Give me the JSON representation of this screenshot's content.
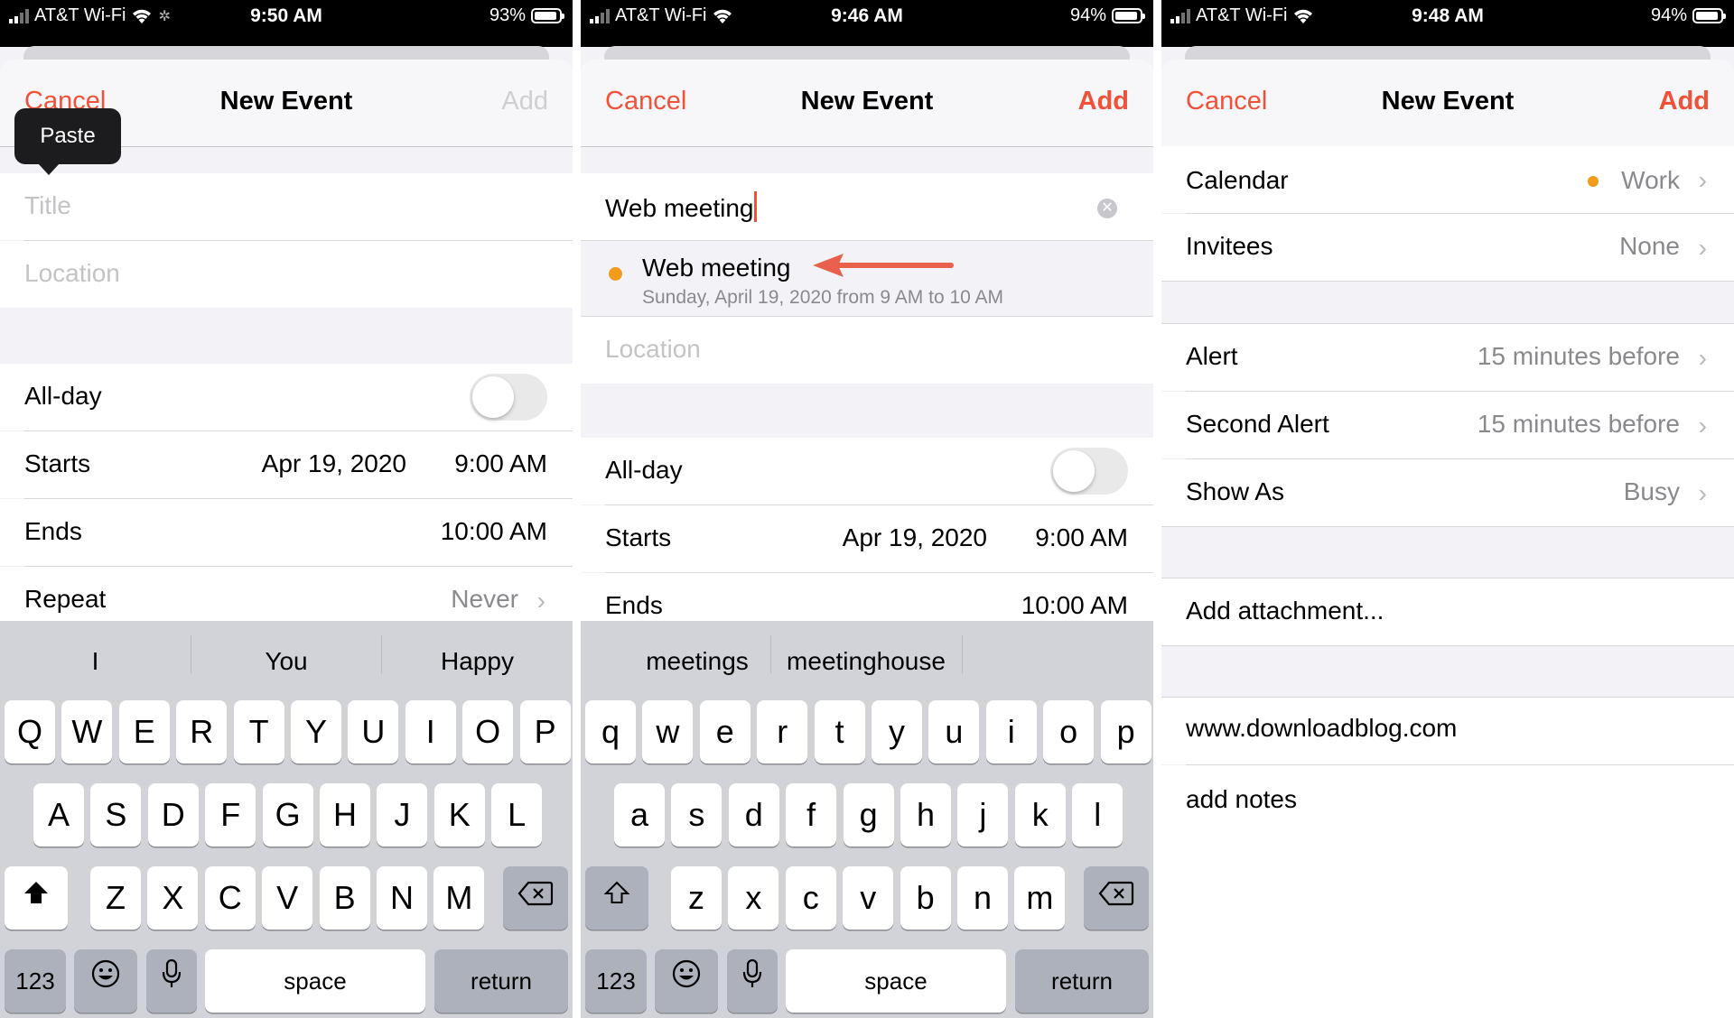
{
  "colors": {
    "accent": "#f05138",
    "calendar_dot": "#f29b1d",
    "arrow": "#e9614c"
  },
  "panels": [
    {
      "status": {
        "carrier": "AT&T Wi-Fi",
        "time": "9:50 AM",
        "battery": "93%"
      },
      "nav": {
        "cancel": "Cancel",
        "title": "New Event",
        "add": "Add"
      },
      "tooltip": "Paste",
      "fields": {
        "title_placeholder": "Title",
        "location_placeholder": "Location"
      },
      "rows": {
        "allday": "All-day",
        "starts": "Starts",
        "starts_date": "Apr 19, 2020",
        "starts_time": "9:00 AM",
        "ends": "Ends",
        "ends_time": "10:00 AM",
        "repeat": "Repeat",
        "repeat_value": "Never"
      },
      "keyboard": {
        "suggestions": [
          "I",
          "You",
          "Happy"
        ],
        "row1": [
          "Q",
          "W",
          "E",
          "R",
          "T",
          "Y",
          "U",
          "I",
          "O",
          "P"
        ],
        "row2": [
          "A",
          "S",
          "D",
          "F",
          "G",
          "H",
          "J",
          "K",
          "L"
        ],
        "row3": [
          "Z",
          "X",
          "C",
          "V",
          "B",
          "N",
          "M"
        ],
        "numbers": "123",
        "space": "space",
        "return": "return"
      }
    },
    {
      "status": {
        "carrier": "AT&T Wi-Fi",
        "time": "9:46 AM",
        "battery": "94%"
      },
      "nav": {
        "cancel": "Cancel",
        "title": "New Event",
        "add": "Add"
      },
      "fields": {
        "title_value": "Web meeting",
        "location_placeholder": "Location"
      },
      "suggestion": {
        "title": "Web meeting",
        "detail": "Sunday, April 19, 2020 from 9 AM to 10 AM"
      },
      "rows": {
        "allday": "All-day",
        "starts": "Starts",
        "starts_date": "Apr 19, 2020",
        "starts_time": "9:00 AM",
        "ends": "Ends",
        "ends_time": "10:00 AM"
      },
      "keyboard": {
        "suggestions": [
          "meetings",
          "meetinghouse"
        ],
        "row1": [
          "q",
          "w",
          "e",
          "r",
          "t",
          "y",
          "u",
          "i",
          "o",
          "p"
        ],
        "row2": [
          "a",
          "s",
          "d",
          "f",
          "g",
          "h",
          "j",
          "k",
          "l"
        ],
        "row3": [
          "z",
          "x",
          "c",
          "v",
          "b",
          "n",
          "m"
        ],
        "numbers": "123",
        "space": "space",
        "return": "return"
      }
    },
    {
      "status": {
        "carrier": "AT&T Wi-Fi",
        "time": "9:48 AM",
        "battery": "94%"
      },
      "nav": {
        "cancel": "Cancel",
        "title": "New Event",
        "add": "Add"
      },
      "rows": {
        "calendar": "Calendar",
        "calendar_value": "Work",
        "invitees": "Invitees",
        "invitees_value": "None",
        "alert": "Alert",
        "alert_value": "15 minutes before",
        "second_alert": "Second Alert",
        "second_alert_value": "15 minutes before",
        "show_as": "Show As",
        "show_as_value": "Busy",
        "attachment": "Add attachment...",
        "url": "www.downloadblog.com",
        "notes": "add notes"
      }
    }
  ]
}
